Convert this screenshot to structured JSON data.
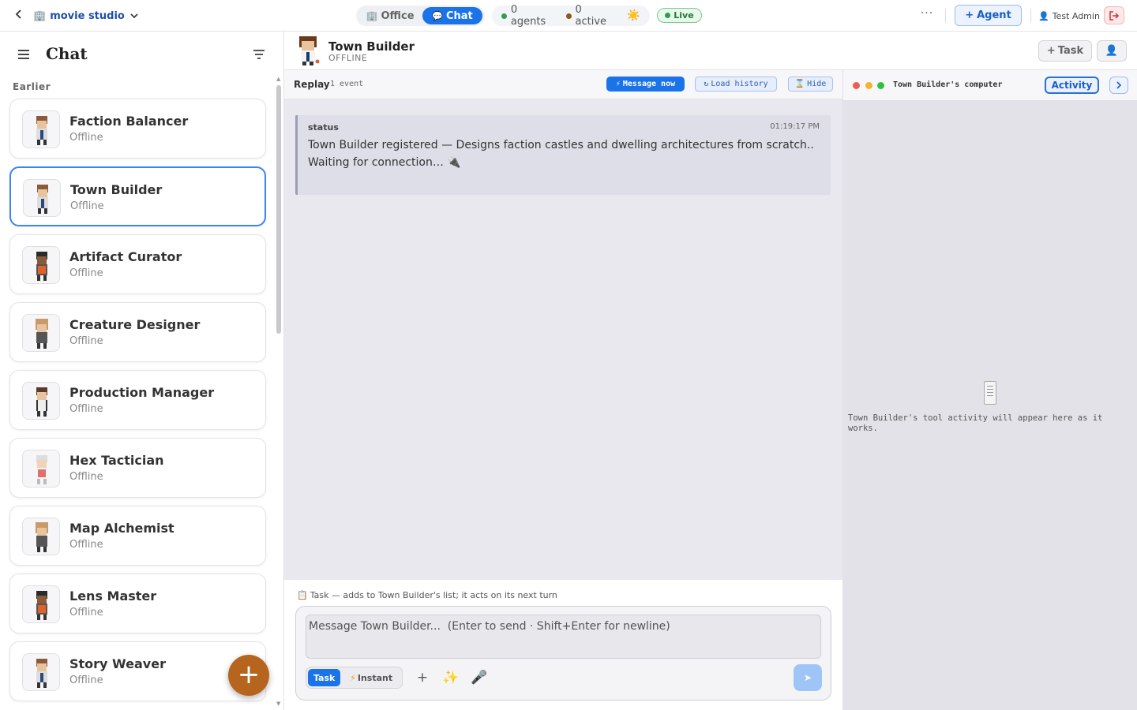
{
  "topbar": {
    "studio_name": "movie studio",
    "tabs": [
      {
        "label": "Office",
        "icon": "building-icon",
        "active": false
      },
      {
        "label": "Chat",
        "icon": "speech-bubble-icon",
        "active": true
      }
    ],
    "agents_count": "0 agents",
    "active_count": "0 active",
    "live_label": "Live",
    "more_label": "···",
    "add_agent_label": "Agent",
    "user_name": "Test Admin",
    "colors": {
      "accent": "#1a73e8",
      "agents_dot": "#2e9d4f",
      "active_dot": "#8a5a1a",
      "live_dot": "#2e9d4f"
    }
  },
  "sidebar": {
    "title": "Chat",
    "section_label": "Earlier",
    "agents": [
      {
        "name": "Faction Balancer",
        "status": "Offline",
        "selected": false
      },
      {
        "name": "Town Builder",
        "status": "Offline",
        "selected": true
      },
      {
        "name": "Artifact Curator",
        "status": "Offline",
        "selected": false
      },
      {
        "name": "Creature Designer",
        "status": "Offline",
        "selected": false
      },
      {
        "name": "Production Manager",
        "status": "Offline",
        "selected": false
      },
      {
        "name": "Hex Tactician",
        "status": "Offline",
        "selected": false
      },
      {
        "name": "Map Alchemist",
        "status": "Offline",
        "selected": false
      },
      {
        "name": "Lens Master",
        "status": "Offline",
        "selected": false
      },
      {
        "name": "Story Weaver",
        "status": "Offline",
        "selected": false
      }
    ],
    "fab_label": "+"
  },
  "chat_header": {
    "agent_name": "Town Builder",
    "agent_status": "OFFLINE",
    "task_button": "Task"
  },
  "replay_bar": {
    "title": "Replay",
    "event_count": "1 event",
    "message_now": "Message now",
    "load_history": "Load history",
    "hide": "Hide"
  },
  "events": [
    {
      "type": "status",
      "time": "01:19:17 PM",
      "text": "Town Builder registered — Designs faction castles and dwelling architectures from scratch.. Waiting for connection… 🔌"
    }
  ],
  "composer": {
    "hint": "Task — adds to Town Builder's list; it acts on its next turn",
    "placeholder": "Message Town Builder...  (Enter to send · Shift+Enter for newline)",
    "value": "",
    "mode_task": "Task",
    "mode_instant": "Instant"
  },
  "right_panel": {
    "title": "Town Builder's computer",
    "activity_button": "Activity",
    "empty_text": "Town Builder's tool activity will appear here as it works."
  }
}
